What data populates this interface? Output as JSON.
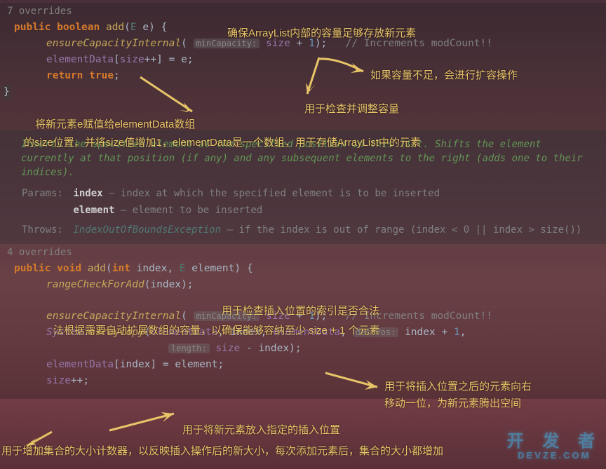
{
  "overrides1": "7 overrides",
  "line1": {
    "kw1": "public",
    "kw2": "boolean",
    "fn": "add",
    "gen": "E",
    "var": "e"
  },
  "line2": {
    "fn": "ensureCapacityInternal",
    "hint": "minCapacity:",
    "field": "size",
    "num": "1",
    "comment": "// Increments modCount!!"
  },
  "line3": {
    "field1": "elementData",
    "field2": "size",
    "var": "e"
  },
  "line4": {
    "kw": "return",
    "val": "true"
  },
  "close_brace": "}",
  "anno1": "确保ArrayList内部的容量足够存放新元素",
  "anno2": "如果容量不足，会进行扩容操作",
  "anno3": "用于检查并调整容量",
  "anno4a": "将新元素e赋值给elementData数组",
  "anno4b": "的size位置，并将size值增加1，elementData是一个数组，用于存储ArrayList中的元素",
  "doc": {
    "desc": "Inserts the specified element at the specified position in this list. Shifts the element currently at that position (if any) and any subsequent elements to the right (adds one to their indices).",
    "params_label": "Params:",
    "p1_name": "index",
    "p1_desc": " – index at which the specified element is to be inserted",
    "p2_name": "element",
    "p2_desc": " – element to be inserted",
    "throws_label": "Throws:",
    "throws_type": "IndexOutOfBoundsException",
    "throws_desc": " – if the index is out of range (",
    "throws_code": "index < 0 || index > size()",
    "throws_end": ")"
  },
  "overrides2": "4 overrides",
  "b1": {
    "kw1": "public",
    "kw2": "void",
    "fn": "add",
    "kw3": "int",
    "var1": "index",
    "gen": "E",
    "var2": "element"
  },
  "b2": {
    "fn": "rangeCheckForAdd",
    "var": "index"
  },
  "b3": {
    "fn": "ensureCapacityInternal",
    "hint": "minCapacity:",
    "field": "size",
    "num": "1",
    "comment": "// Increments modCount!!"
  },
  "b4": {
    "cls": "System",
    "fn": "arraycopy",
    "f1": "elementData",
    "v1": "index",
    "f2": "elementData",
    "hint": "destPos:",
    "v2": "index",
    "num": "1"
  },
  "b5": {
    "hint": "length:",
    "field": "size",
    "var": "index"
  },
  "b6": {
    "field": "elementData",
    "var1": "index",
    "var2": "element"
  },
  "b7": {
    "field": "size"
  },
  "anno5": "用于检查插入位置的索引是否合法",
  "anno6": "法根据需要自动扩展数组的容量，以确保能够容纳至少 size + 1 个元素",
  "anno7a": "用于将插入位置之后的元素向右",
  "anno7b": "移动一位，为新元素腾出空间",
  "anno8": "用于将新元素放入指定的插入位置",
  "anno9": "用于增加集合的大小计数器，以反映插入操作后的新大小，每次添加元素后，集合的大小都增加",
  "watermark": {
    "top": "开 发 者",
    "sub": "DEVZE.COM"
  }
}
